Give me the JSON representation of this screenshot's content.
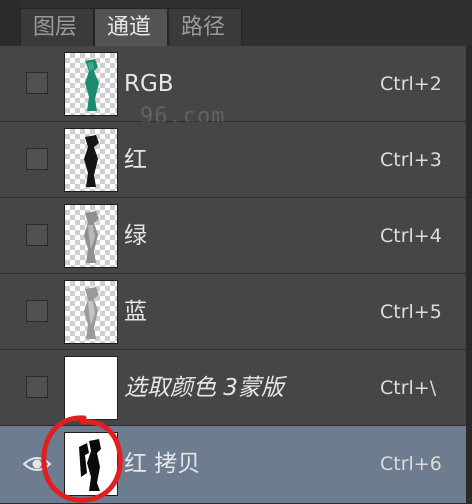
{
  "tabs": [
    {
      "label": "图层",
      "active": false
    },
    {
      "label": "通道",
      "active": true
    },
    {
      "label": "路径",
      "active": false
    }
  ],
  "channels": [
    {
      "name": "RGB",
      "shortcut": "Ctrl+2",
      "visible": false,
      "selected": false,
      "italic": false
    },
    {
      "name": "红",
      "shortcut": "Ctrl+3",
      "visible": false,
      "selected": false,
      "italic": false
    },
    {
      "name": "绿",
      "shortcut": "Ctrl+4",
      "visible": false,
      "selected": false,
      "italic": false
    },
    {
      "name": "蓝",
      "shortcut": "Ctrl+5",
      "visible": false,
      "selected": false,
      "italic": false
    },
    {
      "name": "选取颜色 3蒙版",
      "shortcut": "Ctrl+\\",
      "visible": false,
      "selected": false,
      "italic": true
    },
    {
      "name": "红 拷贝",
      "shortcut": "Ctrl+6",
      "visible": true,
      "selected": true,
      "italic": false
    }
  ],
  "watermark": "96.com",
  "icons": {
    "visibility": "eye-icon",
    "annotation": "red-circle-annotation"
  },
  "colors": {
    "panel_bg": "#464646",
    "selected_row": "#6d7c8f",
    "annotation": "#e02020"
  }
}
